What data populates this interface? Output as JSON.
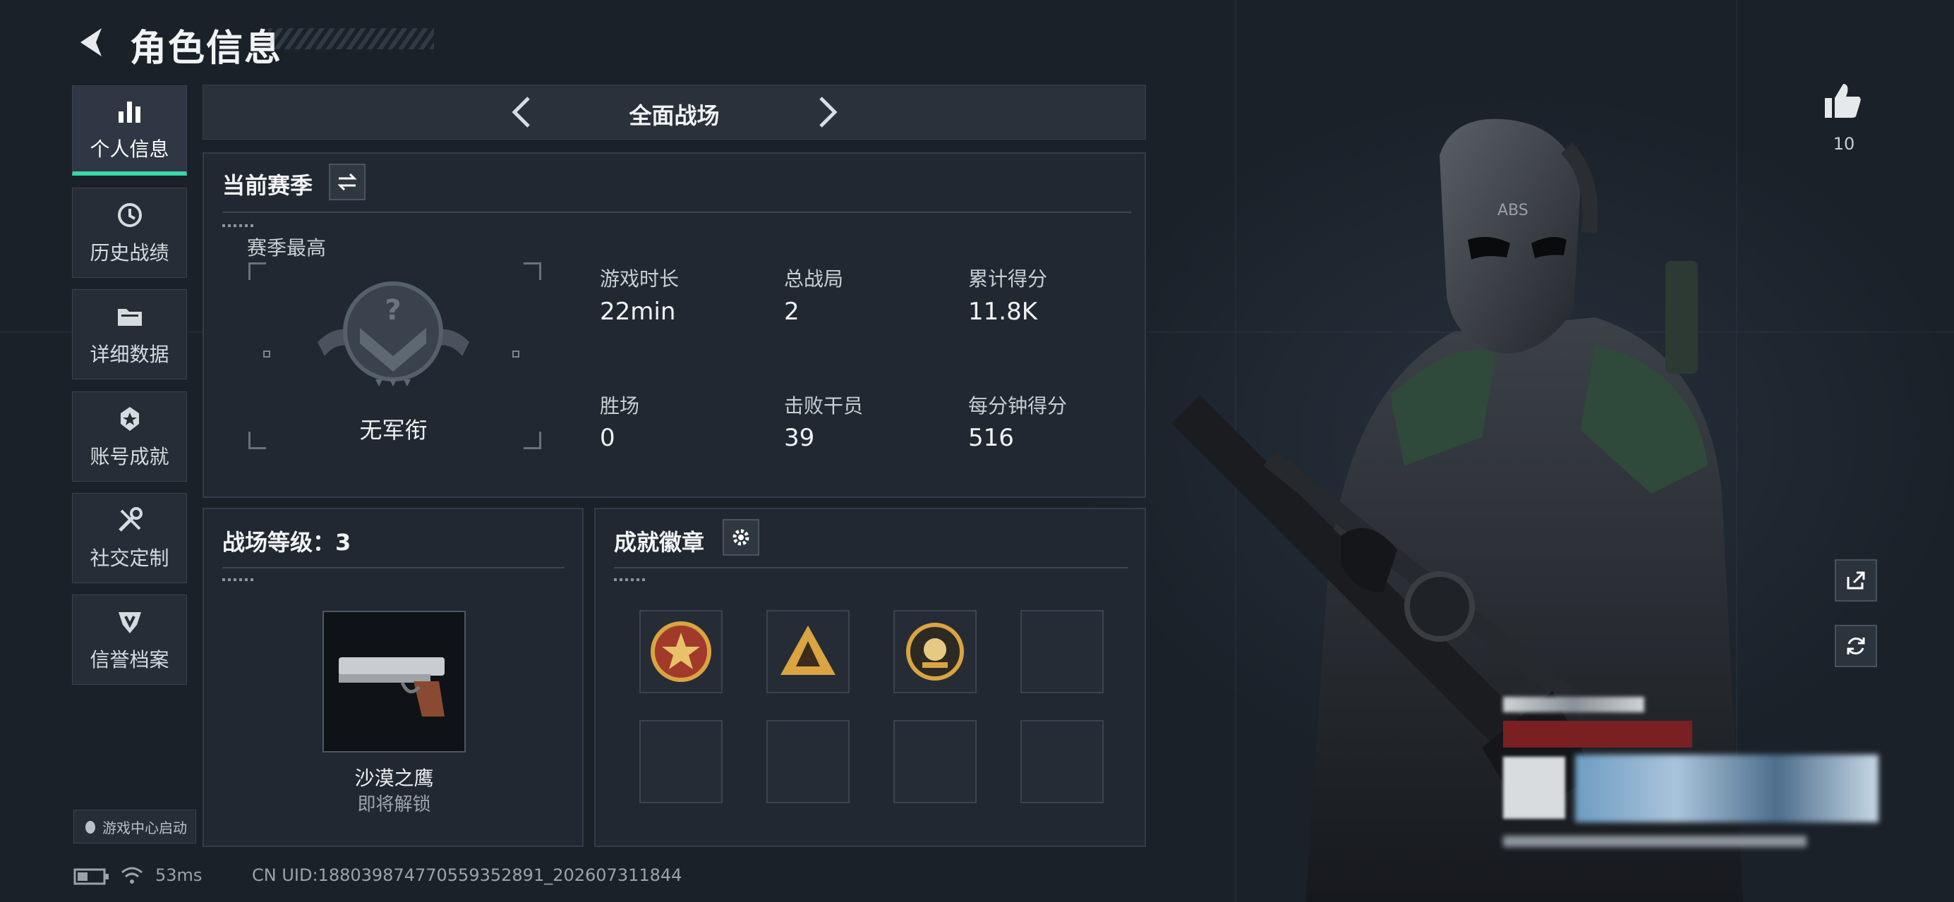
{
  "header": {
    "title": "角色信息"
  },
  "sidebar": {
    "items": [
      {
        "label": "个人信息",
        "icon": "bar-chart-icon",
        "active": true
      },
      {
        "label": "历史战绩",
        "icon": "history-clock-icon"
      },
      {
        "label": "详细数据",
        "icon": "folder-icon"
      },
      {
        "label": "账号成就",
        "icon": "medal-icon"
      },
      {
        "label": "社交定制",
        "icon": "tools-icon"
      },
      {
        "label": "信誉档案",
        "icon": "shield-badge-icon"
      }
    ],
    "game_center_label": "游戏中心启动"
  },
  "mode": {
    "label": "全面战场"
  },
  "season": {
    "title": "当前赛季",
    "peak_label": "赛季最高",
    "rank_name": "无军衔",
    "stats": [
      {
        "label": "游戏时长",
        "value": "22min"
      },
      {
        "label": "总战局",
        "value": "2"
      },
      {
        "label": "累计得分",
        "value": "11.8K"
      },
      {
        "label": "胜场",
        "value": "0"
      },
      {
        "label": "击败干员",
        "value": "39"
      },
      {
        "label": "每分钟得分",
        "value": "516"
      }
    ]
  },
  "battlefield_level": {
    "title": "战场等级：3",
    "weapon_name": "沙漠之鹰",
    "weapon_status": "即将解锁"
  },
  "achievements": {
    "title": "成就徽章"
  },
  "footer": {
    "ping": "53ms",
    "uid": "CN UID:1880398747705593528​91_202607311844"
  },
  "social": {
    "likes": "10"
  },
  "colors": {
    "accent": "#3ad6a8",
    "panel": "#212831",
    "background": "#1b2129"
  }
}
